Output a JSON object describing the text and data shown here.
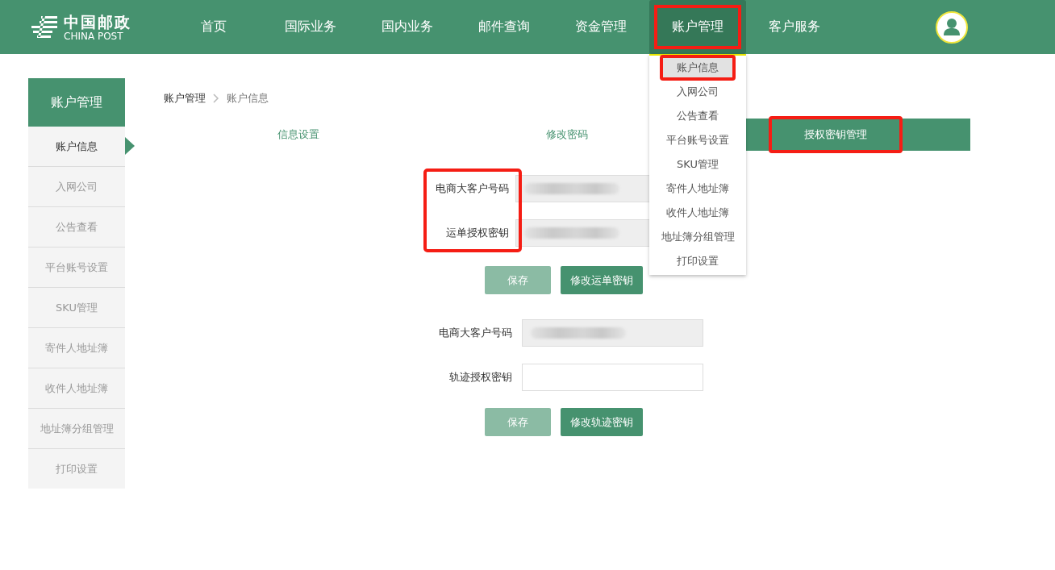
{
  "logo": {
    "name_cn": "中国邮政",
    "name_en": "CHINA POST"
  },
  "nav": [
    {
      "label": "首页",
      "selected": false,
      "highlighted": false
    },
    {
      "label": "国际业务",
      "selected": false,
      "highlighted": false
    },
    {
      "label": "国内业务",
      "selected": false,
      "highlighted": false
    },
    {
      "label": "邮件查询",
      "selected": false,
      "highlighted": false
    },
    {
      "label": "资金管理",
      "selected": false,
      "highlighted": false
    },
    {
      "label": "账户管理",
      "selected": true,
      "highlighted": true,
      "dropdown": [
        {
          "label": "账户信息",
          "selected": true,
          "highlighted": true
        },
        {
          "label": "入网公司",
          "selected": false,
          "highlighted": false
        },
        {
          "label": "公告查看",
          "selected": false,
          "highlighted": false
        },
        {
          "label": "平台账号设置",
          "selected": false,
          "highlighted": false
        },
        {
          "label": "SKU管理",
          "selected": false,
          "highlighted": false
        },
        {
          "label": "寄件人地址簿",
          "selected": false,
          "highlighted": false
        },
        {
          "label": "收件人地址簿",
          "selected": false,
          "highlighted": false
        },
        {
          "label": "地址簿分组管理",
          "selected": false,
          "highlighted": false
        },
        {
          "label": "打印设置",
          "selected": false,
          "highlighted": false
        }
      ]
    },
    {
      "label": "客户服务",
      "selected": false,
      "highlighted": false
    }
  ],
  "sidebar": {
    "title": "账户管理",
    "items": [
      {
        "label": "账户信息",
        "selected": true
      },
      {
        "label": "入网公司",
        "selected": false
      },
      {
        "label": "公告查看",
        "selected": false
      },
      {
        "label": "平台账号设置",
        "selected": false
      },
      {
        "label": "SKU管理",
        "selected": false
      },
      {
        "label": "寄件人地址簿",
        "selected": false
      },
      {
        "label": "收件人地址簿",
        "selected": false
      },
      {
        "label": "地址簿分组管理",
        "selected": false
      },
      {
        "label": "打印设置",
        "selected": false
      }
    ]
  },
  "breadcrumb": [
    "账户管理",
    "账户信息"
  ],
  "tabs": [
    {
      "label": "信息设置",
      "selected": false,
      "highlighted": false
    },
    {
      "label": "修改密码",
      "selected": false,
      "highlighted": false
    },
    {
      "label": "授权密钥管理",
      "selected": true,
      "highlighted": true
    }
  ],
  "forms": [
    {
      "labels_highlighted": true,
      "fields": [
        {
          "label": "电商大客户号码",
          "readonly": true,
          "value_masked": true
        },
        {
          "label": "运单授权密钥",
          "readonly": true,
          "value_masked": true
        }
      ],
      "buttons": [
        {
          "label": "保存",
          "disabled": true
        },
        {
          "label": "修改运单密钥",
          "disabled": false
        }
      ]
    },
    {
      "fields": [
        {
          "label": "电商大客户号码",
          "readonly": true,
          "value_masked": true
        },
        {
          "label": "轨迹授权密钥",
          "readonly": false,
          "value_masked": false
        }
      ],
      "buttons": [
        {
          "label": "保存",
          "disabled": true
        },
        {
          "label": "修改轨迹密钥",
          "disabled": false
        }
      ]
    }
  ]
}
